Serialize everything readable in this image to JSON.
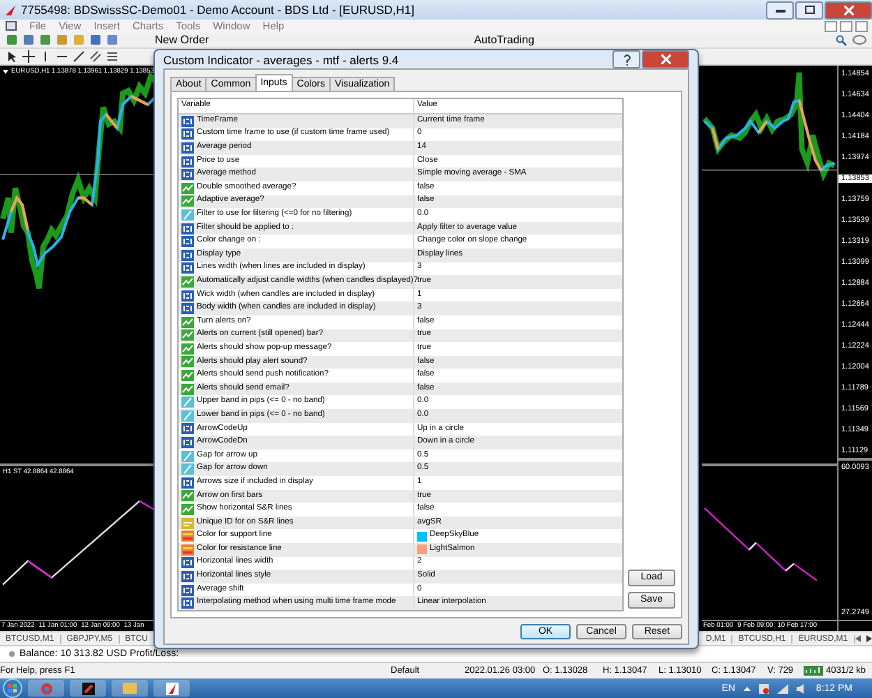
{
  "window": {
    "title": "7755498: BDSwissSC-Demo01 - Demo Account - BDS Ltd - [EURUSD,H1]"
  },
  "menu": [
    "File",
    "View",
    "Insert",
    "Charts",
    "Tools",
    "Window",
    "Help"
  ],
  "toolbar": {
    "buttons": [
      "New Order",
      "AutoTrading"
    ]
  },
  "chart_left": {
    "label": "EURUSD,H1  1.13878 1.13961 1.13829 1.13853",
    "sub_label": "H1 ST  42.8864 42.8864",
    "dates": [
      "7 Jan 2022",
      "11 Jan 01:00",
      "12 Jan 09:00",
      "13 Jan"
    ]
  },
  "chart_right": {
    "price_axis": [
      {
        "text": "1.14854",
        "highlighted": false
      },
      {
        "text": "1.14634",
        "highlighted": false
      },
      {
        "text": "1.14404",
        "highlighted": false
      },
      {
        "text": "1.14184",
        "highlighted": false
      },
      {
        "text": "1.13974",
        "highlighted": false
      },
      {
        "text": "1.13853",
        "highlighted": true
      },
      {
        "text": "1.13759",
        "highlighted": false
      },
      {
        "text": "1.13539",
        "highlighted": false
      },
      {
        "text": "1.13319",
        "highlighted": false
      },
      {
        "text": "1.13099",
        "highlighted": false
      },
      {
        "text": "1.12884",
        "highlighted": false
      },
      {
        "text": "1.12664",
        "highlighted": false
      },
      {
        "text": "1.12444",
        "highlighted": false
      },
      {
        "text": "1.12224",
        "highlighted": false
      },
      {
        "text": "1.12004",
        "highlighted": false
      },
      {
        "text": "1.11789",
        "highlighted": false
      },
      {
        "text": "1.11569",
        "highlighted": false
      },
      {
        "text": "1.11349",
        "highlighted": false
      },
      {
        "text": "1.11129",
        "highlighted": false
      }
    ],
    "sub_axis": [
      "60.0093",
      "27.2749"
    ],
    "dates": [
      "Feb 01:00",
      "9 Feb 09:00",
      "10 Feb 17:00"
    ]
  },
  "chart_tabs_left": [
    "BTCUSD,M1",
    "GBPJPY,M5",
    "BTCU"
  ],
  "chart_tabs_right": [
    "D,M1",
    "BTCUSD,H1",
    "EURUSD,M1"
  ],
  "terminal": {
    "balance": "Balance: 10 313.82 USD  Profit/Loss:"
  },
  "status_bar": [
    "For Help, press F1",
    "Default",
    "2022.01.26 03:00",
    "O: 1.13028",
    "H: 1.13047",
    "L: 1.13010",
    "C: 1.13047",
    "V: 729",
    "4031/2 kb"
  ],
  "taskbar": {
    "language": "EN",
    "time": "8:12 PM"
  },
  "dialog": {
    "title": "Custom Indicator - averages - mtf - alerts  9.4",
    "tabs": [
      {
        "label": "About",
        "selected": false
      },
      {
        "label": "Common",
        "selected": false
      },
      {
        "label": "Inputs",
        "selected": true
      },
      {
        "label": "Colors",
        "selected": false
      },
      {
        "label": "Visualization",
        "selected": false
      }
    ],
    "columns": [
      "Variable",
      "Value"
    ],
    "rows": [
      {
        "variable": "TimeFrame",
        "value": "Current time frame",
        "kind": "int"
      },
      {
        "variable": "Custom time frame to use (if custom time frame used)",
        "value": "0",
        "kind": "int"
      },
      {
        "variable": "Average period",
        "value": "14",
        "kind": "int"
      },
      {
        "variable": "Price to use",
        "value": "Close",
        "kind": "int"
      },
      {
        "variable": "Average method",
        "value": "Simple moving average - SMA",
        "kind": "int"
      },
      {
        "variable": "Double smoothed average?",
        "value": "false",
        "kind": "bool"
      },
      {
        "variable": "Adaptive average?",
        "value": "false",
        "kind": "bool"
      },
      {
        "variable": "Filter to use for filtering (<=0 for no filtering)",
        "value": "0.0",
        "kind": "double"
      },
      {
        "variable": "Filter should be applied to :",
        "value": "Apply filter to average value",
        "kind": "int"
      },
      {
        "variable": "Color change on :",
        "value": "Change color on slope change",
        "kind": "int"
      },
      {
        "variable": "Display type",
        "value": "Display lines",
        "kind": "int"
      },
      {
        "variable": "Lines width (when lines are included in display)",
        "value": "3",
        "kind": "int"
      },
      {
        "variable": "Automatically adjust candle widths (when candles displayed)?",
        "value": "true",
        "kind": "bool"
      },
      {
        "variable": "Wick width (when candles are included in display)",
        "value": "1",
        "kind": "int"
      },
      {
        "variable": "Body width (when candles are included in display)",
        "value": "3",
        "kind": "int"
      },
      {
        "variable": "Turn alerts on?",
        "value": "false",
        "kind": "bool"
      },
      {
        "variable": "Alerts on current (still opened) bar?",
        "value": "true",
        "kind": "bool"
      },
      {
        "variable": "Alerts should show pop-up message?",
        "value": "true",
        "kind": "bool"
      },
      {
        "variable": "Alerts should play alert sound?",
        "value": "false",
        "kind": "bool"
      },
      {
        "variable": "Alerts should send push notification?",
        "value": "false",
        "kind": "bool"
      },
      {
        "variable": "Alerts should send email?",
        "value": "false",
        "kind": "bool"
      },
      {
        "variable": "Upper band in pips (<= 0 - no band)",
        "value": "0.0",
        "kind": "double"
      },
      {
        "variable": "Lower band in pips (<= 0 - no band)",
        "value": "0.0",
        "kind": "double"
      },
      {
        "variable": "ArrowCodeUp",
        "value": "Up in a circle",
        "kind": "int"
      },
      {
        "variable": "ArrowCodeDn",
        "value": "Down in a circle",
        "kind": "int"
      },
      {
        "variable": "Gap for arrow up",
        "value": "0.5",
        "kind": "double"
      },
      {
        "variable": "Gap for arrow down",
        "value": "0.5",
        "kind": "double"
      },
      {
        "variable": "Arrows size if included in display",
        "value": "1",
        "kind": "int"
      },
      {
        "variable": "Arrow on first bars",
        "value": "true",
        "kind": "bool"
      },
      {
        "variable": "Show horizontal S&R lines",
        "value": "false",
        "kind": "bool"
      },
      {
        "variable": "Unique ID for on S&R lines",
        "value": "avgSR",
        "kind": "string"
      },
      {
        "variable": "Color for support line",
        "value": "DeepSkyBlue",
        "kind": "color",
        "color": "#00bfff"
      },
      {
        "variable": "Color for resistance line",
        "value": "LightSalmon",
        "kind": "color",
        "color": "#ffa07a"
      },
      {
        "variable": "Horizontal lines width",
        "value": "2",
        "kind": "int"
      },
      {
        "variable": "Horizontal lines style",
        "value": "Solid",
        "kind": "int"
      },
      {
        "variable": "Average shift",
        "value": "0",
        "kind": "int"
      },
      {
        "variable": "Interpolating method when using multi time frame mode",
        "value": "Linear interpolation",
        "kind": "int"
      }
    ],
    "side_buttons": [
      "Load",
      "Save"
    ],
    "buttons": [
      "OK",
      "Cancel",
      "Reset"
    ]
  }
}
